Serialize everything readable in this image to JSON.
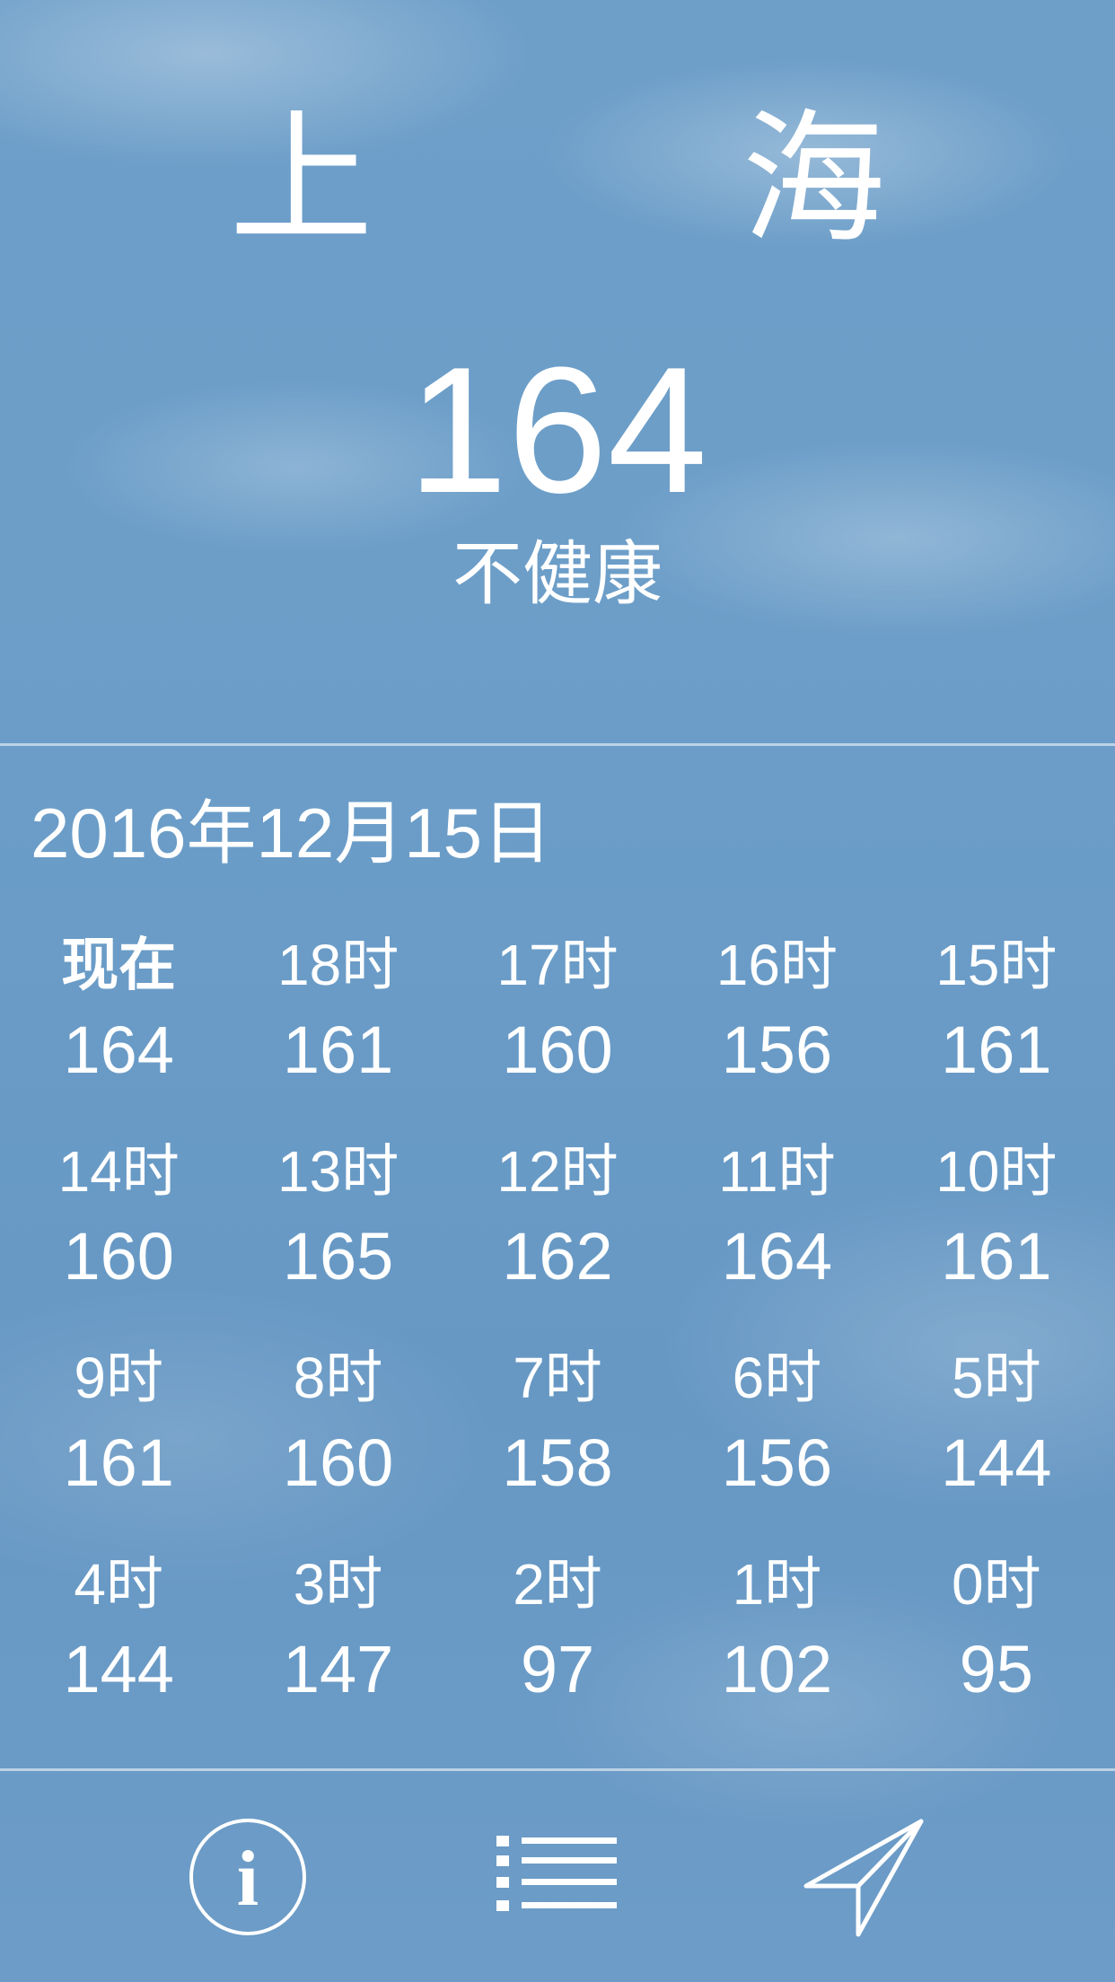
{
  "header": {
    "city": "上 海",
    "aqi": "164",
    "status": "不健康"
  },
  "date": "2016年12月15日",
  "hourly": [
    {
      "label": "现在",
      "value": "164"
    },
    {
      "label": "18时",
      "value": "161"
    },
    {
      "label": "17时",
      "value": "160"
    },
    {
      "label": "16时",
      "value": "156"
    },
    {
      "label": "15时",
      "value": "161"
    },
    {
      "label": "14时",
      "value": "160"
    },
    {
      "label": "13时",
      "value": "165"
    },
    {
      "label": "12时",
      "value": "162"
    },
    {
      "label": "11时",
      "value": "164"
    },
    {
      "label": "10时",
      "value": "161"
    },
    {
      "label": "9时",
      "value": "161"
    },
    {
      "label": "8时",
      "value": "160"
    },
    {
      "label": "7时",
      "value": "158"
    },
    {
      "label": "6时",
      "value": "156"
    },
    {
      "label": "5时",
      "value": "144"
    },
    {
      "label": "4时",
      "value": "144"
    },
    {
      "label": "3时",
      "value": "147"
    },
    {
      "label": "2时",
      "value": "97"
    },
    {
      "label": "1时",
      "value": "102"
    },
    {
      "label": "0时",
      "value": "95"
    }
  ],
  "toolbar": {
    "info_icon": "info-icon",
    "list_icon": "list-icon",
    "location_icon": "location-arrow-icon"
  },
  "colors": {
    "background": "#6a9cc6",
    "text": "#ffffff"
  }
}
